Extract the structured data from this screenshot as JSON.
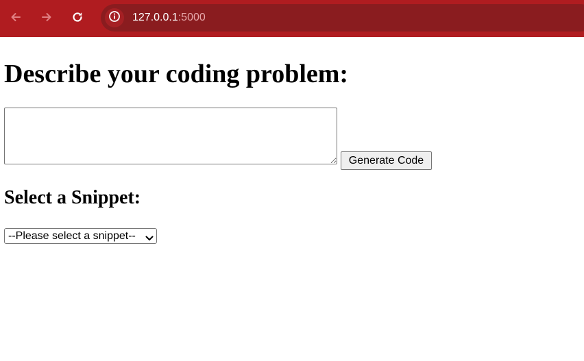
{
  "browser": {
    "url_host": "127.0.0.1",
    "url_port": ":5000",
    "icons": {
      "back": "arrow-left-icon",
      "forward": "arrow-right-icon",
      "reload": "reload-icon",
      "site_info": "info-icon"
    },
    "colors": {
      "toolbar": "#b01c20",
      "omnibox": "#8a1c1f"
    }
  },
  "main": {
    "title": "Describe your coding problem:",
    "problem_textarea": {
      "value": "",
      "placeholder": ""
    },
    "generate_button_label": "Generate Code",
    "snippet_heading": "Select a Snippet:",
    "snippet_select": {
      "selected": "--Please select a snippet--"
    }
  }
}
